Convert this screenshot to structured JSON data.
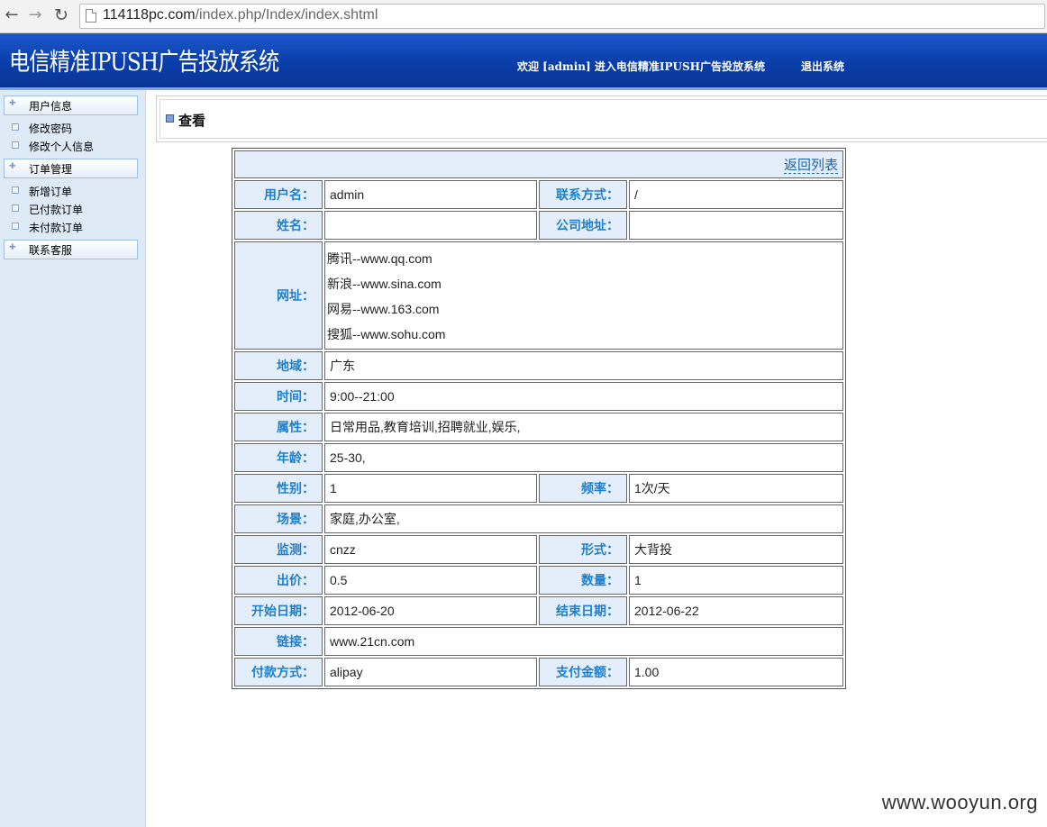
{
  "browser": {
    "back_icon": "arrow-left-icon",
    "forward_icon": "arrow-right-icon",
    "reload_icon": "reload-icon",
    "url_host": "114118pc.com",
    "url_path": "/index.php/Index/index.shtml"
  },
  "header": {
    "title": "电信精准IPUSH广告投放系统",
    "welcome": "欢迎 [admin] 进入电信精准IPUSH广告投放系统",
    "logout": "退出系统"
  },
  "sidebar": {
    "groups": [
      {
        "label": "用户信息",
        "items": [
          "修改密码",
          "修改个人信息"
        ]
      },
      {
        "label": "订单管理",
        "items": [
          "新增订单",
          "已付款订单",
          "未付款订单"
        ]
      },
      {
        "label": "联系客服",
        "items": []
      }
    ]
  },
  "main": {
    "view_title": "查看",
    "back_link": "返回列表",
    "fields": {
      "username_label": "用户名：",
      "username": "admin",
      "contact_label": "联系方式：",
      "contact": "/",
      "name_label": "姓名：",
      "name": "",
      "address_label": "公司地址：",
      "address": "",
      "sites_label": "网址：",
      "sites": [
        "腾讯--www.qq.com",
        "新浪--www.sina.com",
        "网易--www.163.com",
        "搜狐--www.sohu.com"
      ],
      "region_label": "地域：",
      "region": "广东",
      "time_label": "时间：",
      "time": "9:00--21:00",
      "attr_label": "属性：",
      "attr": "日常用品,教育培训,招聘就业,娱乐,",
      "age_label": "年龄：",
      "age": "25-30,",
      "gender_label": "性别：",
      "gender": "1",
      "freq_label": "频率：",
      "freq": "1次/天",
      "scene_label": "场景：",
      "scene": "家庭,办公室,",
      "monitor_label": "监测：",
      "monitor": "cnzz",
      "form_label": "形式：",
      "form": "大背投",
      "bid_label": "出价：",
      "bid": "0.5",
      "qty_label": "数量：",
      "qty": "1",
      "start_label": "开始日期：",
      "start": "2012-06-20",
      "end_label": "结束日期：",
      "end": "2012-06-22",
      "link_label": "链接：",
      "link": "www.21cn.com",
      "pay_method_label": "付款方式：",
      "pay_method": "alipay",
      "pay_amount_label": "支付金额：",
      "pay_amount": "1.00"
    }
  },
  "watermark": "www.wooyun.org",
  "colors": {
    "header_blue": "#0a3ea8",
    "label_blue": "#1e7fcf",
    "amount_red": "#e8261e",
    "sidebar_bg": "#dfeaf7"
  }
}
